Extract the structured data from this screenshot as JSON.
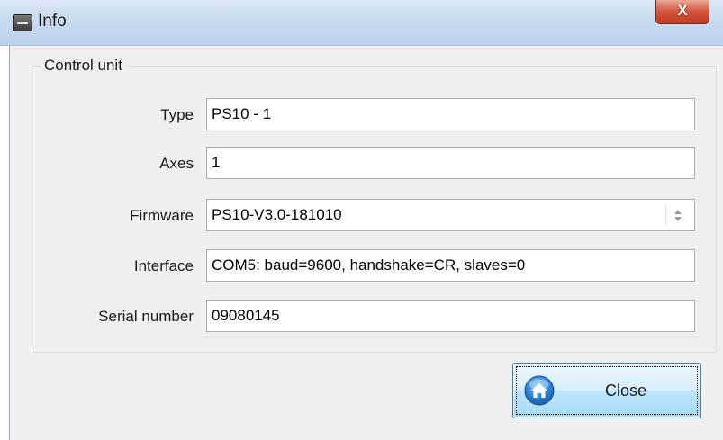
{
  "window": {
    "title": "Info",
    "close_glyph": "X"
  },
  "group": {
    "legend": "Control unit"
  },
  "fields": {
    "type": {
      "label": "Type",
      "value": "PS10 - 1"
    },
    "axes": {
      "label": "Axes",
      "value": "1"
    },
    "firmware": {
      "label": "Firmware",
      "value": "PS10-V3.0-181010"
    },
    "interface": {
      "label": "Interface",
      "value": "COM5: baud=9600, handshake=CR, slaves=0"
    },
    "serial": {
      "label": "Serial number",
      "value": "09080145"
    }
  },
  "buttons": {
    "close_label": "Close",
    "close_icon": "home-icon"
  },
  "colors": {
    "button_accent": "#3c7fb1",
    "close_red": "#c23a20"
  }
}
